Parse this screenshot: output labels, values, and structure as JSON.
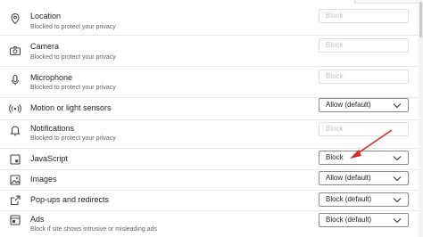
{
  "settings": [
    {
      "title": "Location",
      "subtitle": "Blocked to protect your privacy",
      "icon": "location-icon",
      "value": "Block",
      "disabled": true
    },
    {
      "title": "Camera",
      "subtitle": "Blocked to protect your privacy",
      "icon": "camera-icon",
      "value": "Block",
      "disabled": true
    },
    {
      "title": "Microphone",
      "subtitle": "Blocked to protect your privacy",
      "icon": "microphone-icon",
      "value": "Block",
      "disabled": true
    },
    {
      "title": "Motion or light sensors",
      "subtitle": "",
      "icon": "sensors-icon",
      "value": "Allow (default)",
      "disabled": false
    },
    {
      "title": "Notifications",
      "subtitle": "Blocked to protect your privacy",
      "icon": "bell-icon",
      "value": "Block",
      "disabled": true
    },
    {
      "title": "JavaScript",
      "subtitle": "",
      "icon": "javascript-icon",
      "value": "Block",
      "disabled": false
    },
    {
      "title": "Images",
      "subtitle": "",
      "icon": "image-icon",
      "value": "Allow (default)",
      "disabled": false
    },
    {
      "title": "Pop-ups and redirects",
      "subtitle": "",
      "icon": "popup-icon",
      "value": "Block (default)",
      "disabled": false
    },
    {
      "title": "Ads",
      "subtitle": "Block if site shows intrusive or misleading ads",
      "icon": "ads-icon",
      "value": "Block (default)",
      "disabled": false
    }
  ],
  "colors": {
    "annotation_arrow": "#d42a2a",
    "text": "#1f1f1f",
    "subtext": "#616161",
    "disabled_text": "#c4c4c4"
  }
}
